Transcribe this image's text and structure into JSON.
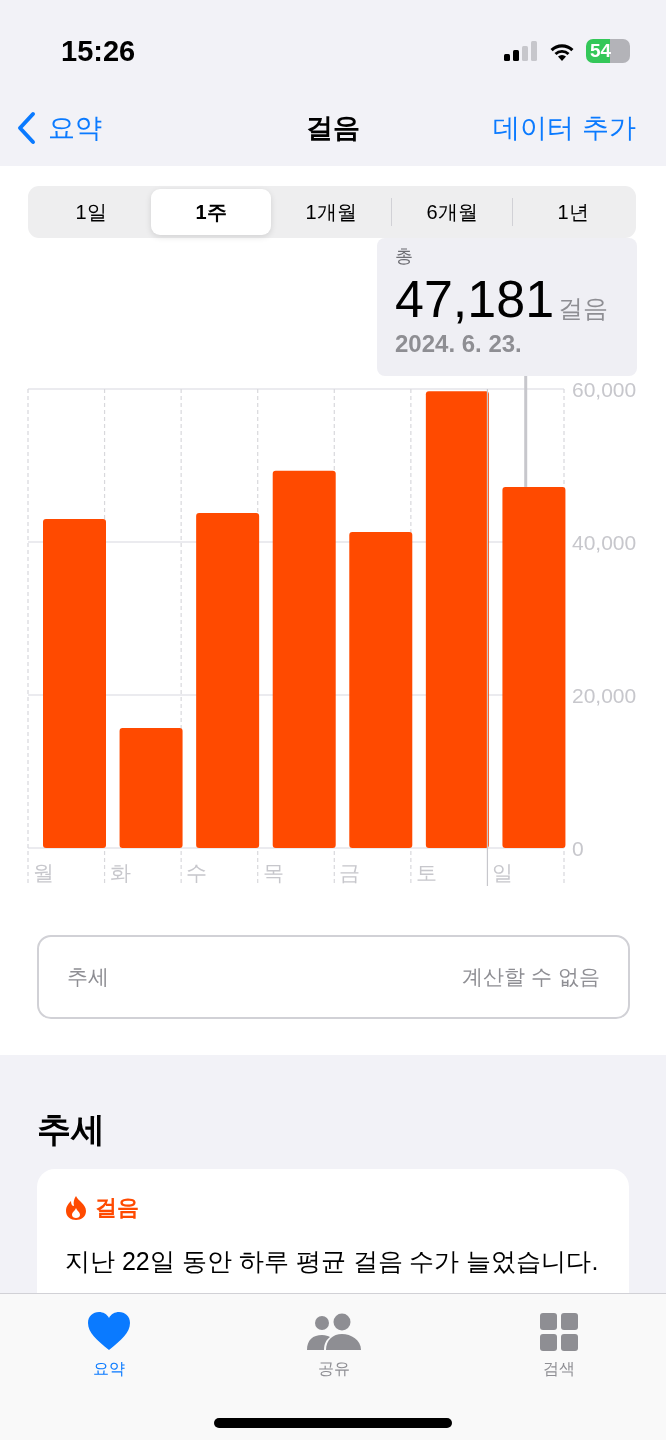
{
  "status_bar": {
    "time": "15:26",
    "battery": "54"
  },
  "nav": {
    "back": "요약",
    "title": "걸음",
    "action": "데이터 추가"
  },
  "segments": [
    {
      "label": "1일",
      "selected": false
    },
    {
      "label": "1주",
      "selected": true
    },
    {
      "label": "1개월",
      "selected": false
    },
    {
      "label": "6개월",
      "selected": false
    },
    {
      "label": "1년",
      "selected": false
    }
  ],
  "chart_data": {
    "type": "bar",
    "categories": [
      "월",
      "화",
      "수",
      "목",
      "금",
      "토",
      "일"
    ],
    "series": [
      {
        "color": "#ff4a00",
        "values": [
          43000,
          15700,
          43800,
          49300,
          41300,
          59700,
          47200
        ]
      }
    ],
    "ylim": [
      0,
      60000
    ],
    "yticks": [
      {
        "value": 0,
        "label": "0"
      },
      {
        "value": 20000,
        "label": "20,000"
      },
      {
        "value": 40000,
        "label": "40,000"
      },
      {
        "value": 60000,
        "label": "60,000"
      }
    ],
    "ref_lines": [
      {
        "axis": "x",
        "value": "일"
      }
    ]
  },
  "tooltip": {
    "title": "총",
    "value": "47,181",
    "unit": "걸음",
    "date": "2024. 6. 23."
  },
  "trend_row": {
    "label": "추세",
    "value": "계산할 수 없음"
  },
  "trends": {
    "heading": "추세",
    "card_title": "걸음",
    "text": "지난 22일 동안 하루 평균 걸음 수가 늘었습니다."
  },
  "tab_bar": [
    {
      "label": "요약",
      "selected": true,
      "kind": "heart"
    },
    {
      "label": "공유",
      "selected": false,
      "kind": "people"
    },
    {
      "label": "검색",
      "selected": false,
      "kind": "grid"
    }
  ]
}
